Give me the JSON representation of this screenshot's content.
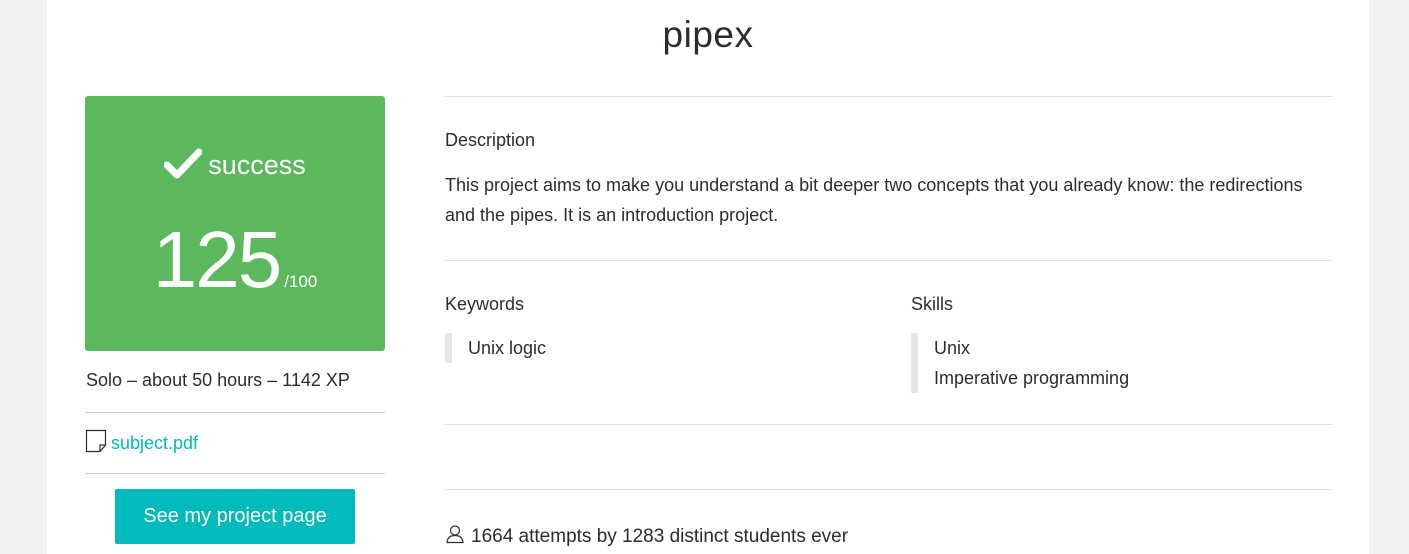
{
  "project": {
    "title": "pipex"
  },
  "grade": {
    "status": "success",
    "score": "125",
    "max": "/100",
    "color": "#5cb85c"
  },
  "meta": {
    "summary": "Solo – about 50 hours – 1142 XP"
  },
  "subject": {
    "icon": "document-icon",
    "link_label": "subject.pdf"
  },
  "actions": {
    "project_page_label": "See my project page",
    "accent": "#00babc"
  },
  "description": {
    "label": "Description",
    "text": "This project aims to make you understand a bit deeper two concepts that you already know: the redirections and the pipes. It is an introduction project."
  },
  "keywords": {
    "label": "Keywords",
    "items": [
      "Unix logic"
    ]
  },
  "skills": {
    "label": "Skills",
    "items": [
      "Unix",
      "Imperative programming"
    ]
  },
  "stats": {
    "icon": "user-icon",
    "text": "1664 attempts by 1283 distinct students ever"
  }
}
